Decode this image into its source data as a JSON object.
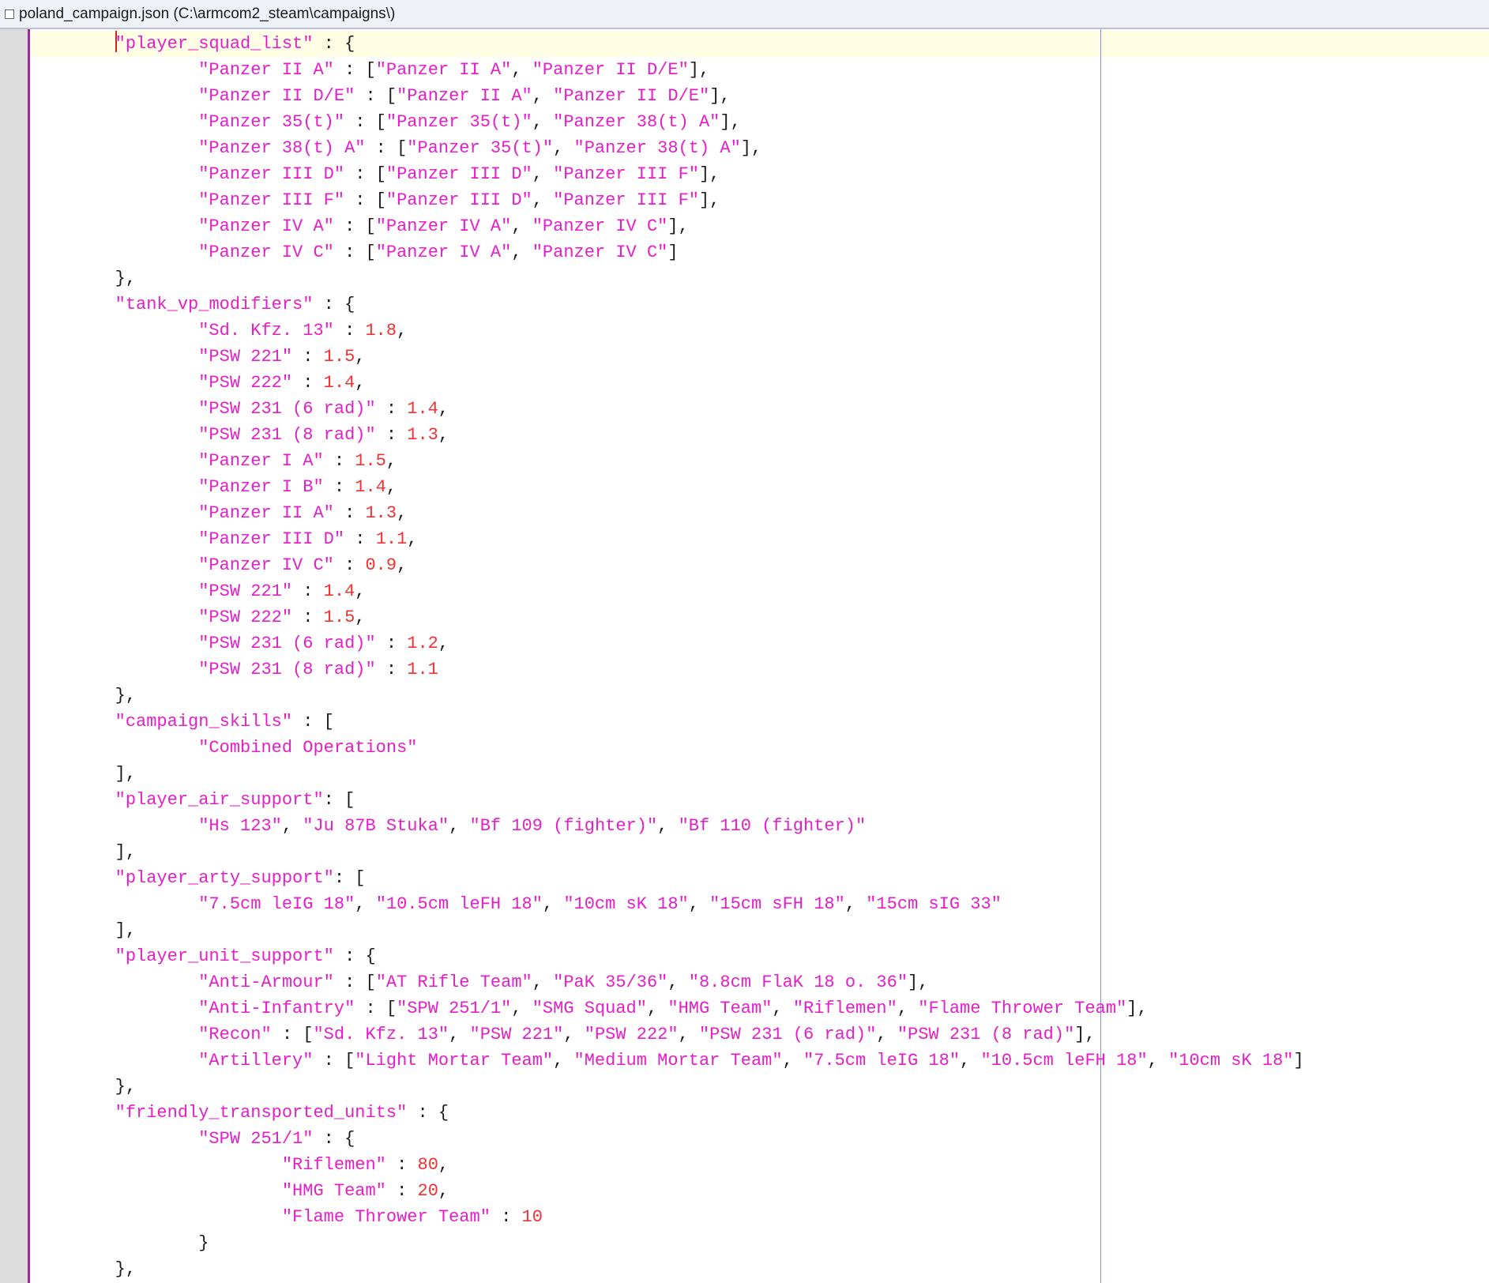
{
  "window": {
    "title": "poland_campaign.json (C:\\armcom2_steam\\campaigns\\)"
  },
  "colors": {
    "string": "#e61ec8",
    "number": "#f03232",
    "punctuation": "#1b1b1b",
    "current_line": "#fffde3",
    "gutter_border": "#9b2a9b",
    "wrap_guide": "#8c8cff"
  },
  "editor": {
    "caret_line": 0,
    "lines": [
      [
        {
          "t": "p",
          "v": "        "
        },
        {
          "t": "s",
          "v": "\"player_squad_list\""
        },
        {
          "t": "p",
          "v": " : {"
        }
      ],
      [
        {
          "t": "p",
          "v": "                "
        },
        {
          "t": "s",
          "v": "\"Panzer II A\""
        },
        {
          "t": "p",
          "v": " : ["
        },
        {
          "t": "s",
          "v": "\"Panzer II A\""
        },
        {
          "t": "p",
          "v": ", "
        },
        {
          "t": "s",
          "v": "\"Panzer II D/E\""
        },
        {
          "t": "p",
          "v": "],"
        }
      ],
      [
        {
          "t": "p",
          "v": "                "
        },
        {
          "t": "s",
          "v": "\"Panzer II D/E\""
        },
        {
          "t": "p",
          "v": " : ["
        },
        {
          "t": "s",
          "v": "\"Panzer II A\""
        },
        {
          "t": "p",
          "v": ", "
        },
        {
          "t": "s",
          "v": "\"Panzer II D/E\""
        },
        {
          "t": "p",
          "v": "],"
        }
      ],
      [
        {
          "t": "p",
          "v": "                "
        },
        {
          "t": "s",
          "v": "\"Panzer 35(t)\""
        },
        {
          "t": "p",
          "v": " : ["
        },
        {
          "t": "s",
          "v": "\"Panzer 35(t)\""
        },
        {
          "t": "p",
          "v": ", "
        },
        {
          "t": "s",
          "v": "\"Panzer 38(t) A\""
        },
        {
          "t": "p",
          "v": "],"
        }
      ],
      [
        {
          "t": "p",
          "v": "                "
        },
        {
          "t": "s",
          "v": "\"Panzer 38(t) A\""
        },
        {
          "t": "p",
          "v": " : ["
        },
        {
          "t": "s",
          "v": "\"Panzer 35(t)\""
        },
        {
          "t": "p",
          "v": ", "
        },
        {
          "t": "s",
          "v": "\"Panzer 38(t) A\""
        },
        {
          "t": "p",
          "v": "],"
        }
      ],
      [
        {
          "t": "p",
          "v": "                "
        },
        {
          "t": "s",
          "v": "\"Panzer III D\""
        },
        {
          "t": "p",
          "v": " : ["
        },
        {
          "t": "s",
          "v": "\"Panzer III D\""
        },
        {
          "t": "p",
          "v": ", "
        },
        {
          "t": "s",
          "v": "\"Panzer III F\""
        },
        {
          "t": "p",
          "v": "],"
        }
      ],
      [
        {
          "t": "p",
          "v": "                "
        },
        {
          "t": "s",
          "v": "\"Panzer III F\""
        },
        {
          "t": "p",
          "v": " : ["
        },
        {
          "t": "s",
          "v": "\"Panzer III D\""
        },
        {
          "t": "p",
          "v": ", "
        },
        {
          "t": "s",
          "v": "\"Panzer III F\""
        },
        {
          "t": "p",
          "v": "],"
        }
      ],
      [
        {
          "t": "p",
          "v": "                "
        },
        {
          "t": "s",
          "v": "\"Panzer IV A\""
        },
        {
          "t": "p",
          "v": " : ["
        },
        {
          "t": "s",
          "v": "\"Panzer IV A\""
        },
        {
          "t": "p",
          "v": ", "
        },
        {
          "t": "s",
          "v": "\"Panzer IV C\""
        },
        {
          "t": "p",
          "v": "],"
        }
      ],
      [
        {
          "t": "p",
          "v": "                "
        },
        {
          "t": "s",
          "v": "\"Panzer IV C\""
        },
        {
          "t": "p",
          "v": " : ["
        },
        {
          "t": "s",
          "v": "\"Panzer IV A\""
        },
        {
          "t": "p",
          "v": ", "
        },
        {
          "t": "s",
          "v": "\"Panzer IV C\""
        },
        {
          "t": "p",
          "v": "]"
        }
      ],
      [
        {
          "t": "p",
          "v": "        },"
        }
      ],
      [
        {
          "t": "p",
          "v": "        "
        },
        {
          "t": "s",
          "v": "\"tank_vp_modifiers\""
        },
        {
          "t": "p",
          "v": " : {"
        }
      ],
      [
        {
          "t": "p",
          "v": "                "
        },
        {
          "t": "s",
          "v": "\"Sd. Kfz. 13\""
        },
        {
          "t": "p",
          "v": " : "
        },
        {
          "t": "n",
          "v": "1.8"
        },
        {
          "t": "p",
          "v": ","
        }
      ],
      [
        {
          "t": "p",
          "v": "                "
        },
        {
          "t": "s",
          "v": "\"PSW 221\""
        },
        {
          "t": "p",
          "v": " : "
        },
        {
          "t": "n",
          "v": "1.5"
        },
        {
          "t": "p",
          "v": ","
        }
      ],
      [
        {
          "t": "p",
          "v": "                "
        },
        {
          "t": "s",
          "v": "\"PSW 222\""
        },
        {
          "t": "p",
          "v": " : "
        },
        {
          "t": "n",
          "v": "1.4"
        },
        {
          "t": "p",
          "v": ","
        }
      ],
      [
        {
          "t": "p",
          "v": "                "
        },
        {
          "t": "s",
          "v": "\"PSW 231 (6 rad)\""
        },
        {
          "t": "p",
          "v": " : "
        },
        {
          "t": "n",
          "v": "1.4"
        },
        {
          "t": "p",
          "v": ","
        }
      ],
      [
        {
          "t": "p",
          "v": "                "
        },
        {
          "t": "s",
          "v": "\"PSW 231 (8 rad)\""
        },
        {
          "t": "p",
          "v": " : "
        },
        {
          "t": "n",
          "v": "1.3"
        },
        {
          "t": "p",
          "v": ","
        }
      ],
      [
        {
          "t": "p",
          "v": "                "
        },
        {
          "t": "s",
          "v": "\"Panzer I A\""
        },
        {
          "t": "p",
          "v": " : "
        },
        {
          "t": "n",
          "v": "1.5"
        },
        {
          "t": "p",
          "v": ","
        }
      ],
      [
        {
          "t": "p",
          "v": "                "
        },
        {
          "t": "s",
          "v": "\"Panzer I B\""
        },
        {
          "t": "p",
          "v": " : "
        },
        {
          "t": "n",
          "v": "1.4"
        },
        {
          "t": "p",
          "v": ","
        }
      ],
      [
        {
          "t": "p",
          "v": "                "
        },
        {
          "t": "s",
          "v": "\"Panzer II A\""
        },
        {
          "t": "p",
          "v": " : "
        },
        {
          "t": "n",
          "v": "1.3"
        },
        {
          "t": "p",
          "v": ","
        }
      ],
      [
        {
          "t": "p",
          "v": "                "
        },
        {
          "t": "s",
          "v": "\"Panzer III D\""
        },
        {
          "t": "p",
          "v": " : "
        },
        {
          "t": "n",
          "v": "1.1"
        },
        {
          "t": "p",
          "v": ","
        }
      ],
      [
        {
          "t": "p",
          "v": "                "
        },
        {
          "t": "s",
          "v": "\"Panzer IV C\""
        },
        {
          "t": "p",
          "v": " : "
        },
        {
          "t": "n",
          "v": "0.9"
        },
        {
          "t": "p",
          "v": ","
        }
      ],
      [
        {
          "t": "p",
          "v": "                "
        },
        {
          "t": "s",
          "v": "\"PSW 221\""
        },
        {
          "t": "p",
          "v": " : "
        },
        {
          "t": "n",
          "v": "1.4"
        },
        {
          "t": "p",
          "v": ","
        }
      ],
      [
        {
          "t": "p",
          "v": "                "
        },
        {
          "t": "s",
          "v": "\"PSW 222\""
        },
        {
          "t": "p",
          "v": " : "
        },
        {
          "t": "n",
          "v": "1.5"
        },
        {
          "t": "p",
          "v": ","
        }
      ],
      [
        {
          "t": "p",
          "v": "                "
        },
        {
          "t": "s",
          "v": "\"PSW 231 (6 rad)\""
        },
        {
          "t": "p",
          "v": " : "
        },
        {
          "t": "n",
          "v": "1.2"
        },
        {
          "t": "p",
          "v": ","
        }
      ],
      [
        {
          "t": "p",
          "v": "                "
        },
        {
          "t": "s",
          "v": "\"PSW 231 (8 rad)\""
        },
        {
          "t": "p",
          "v": " : "
        },
        {
          "t": "n",
          "v": "1.1"
        }
      ],
      [
        {
          "t": "p",
          "v": "        },"
        }
      ],
      [
        {
          "t": "p",
          "v": "        "
        },
        {
          "t": "s",
          "v": "\"campaign_skills\""
        },
        {
          "t": "p",
          "v": " : ["
        }
      ],
      [
        {
          "t": "p",
          "v": "                "
        },
        {
          "t": "s",
          "v": "\"Combined Operations\""
        }
      ],
      [
        {
          "t": "p",
          "v": "        ],"
        }
      ],
      [
        {
          "t": "p",
          "v": "        "
        },
        {
          "t": "s",
          "v": "\"player_air_support\""
        },
        {
          "t": "p",
          "v": ": ["
        }
      ],
      [
        {
          "t": "p",
          "v": "                "
        },
        {
          "t": "s",
          "v": "\"Hs 123\""
        },
        {
          "t": "p",
          "v": ", "
        },
        {
          "t": "s",
          "v": "\"Ju 87B Stuka\""
        },
        {
          "t": "p",
          "v": ", "
        },
        {
          "t": "s",
          "v": "\"Bf 109 (fighter)\""
        },
        {
          "t": "p",
          "v": ", "
        },
        {
          "t": "s",
          "v": "\"Bf 110 (fighter)\""
        }
      ],
      [
        {
          "t": "p",
          "v": "        ],"
        }
      ],
      [
        {
          "t": "p",
          "v": "        "
        },
        {
          "t": "s",
          "v": "\"player_arty_support\""
        },
        {
          "t": "p",
          "v": ": ["
        }
      ],
      [
        {
          "t": "p",
          "v": "                "
        },
        {
          "t": "s",
          "v": "\"7.5cm leIG 18\""
        },
        {
          "t": "p",
          "v": ", "
        },
        {
          "t": "s",
          "v": "\"10.5cm leFH 18\""
        },
        {
          "t": "p",
          "v": ", "
        },
        {
          "t": "s",
          "v": "\"10cm sK 18\""
        },
        {
          "t": "p",
          "v": ", "
        },
        {
          "t": "s",
          "v": "\"15cm sFH 18\""
        },
        {
          "t": "p",
          "v": ", "
        },
        {
          "t": "s",
          "v": "\"15cm sIG 33\""
        }
      ],
      [
        {
          "t": "p",
          "v": "        ],"
        }
      ],
      [
        {
          "t": "p",
          "v": "        "
        },
        {
          "t": "s",
          "v": "\"player_unit_support\""
        },
        {
          "t": "p",
          "v": " : {"
        }
      ],
      [
        {
          "t": "p",
          "v": "                "
        },
        {
          "t": "s",
          "v": "\"Anti-Armour\""
        },
        {
          "t": "p",
          "v": " : ["
        },
        {
          "t": "s",
          "v": "\"AT Rifle Team\""
        },
        {
          "t": "p",
          "v": ", "
        },
        {
          "t": "s",
          "v": "\"PaK 35/36\""
        },
        {
          "t": "p",
          "v": ", "
        },
        {
          "t": "s",
          "v": "\"8.8cm FlaK 18 o. 36\""
        },
        {
          "t": "p",
          "v": "],"
        }
      ],
      [
        {
          "t": "p",
          "v": "                "
        },
        {
          "t": "s",
          "v": "\"Anti-Infantry\""
        },
        {
          "t": "p",
          "v": " : ["
        },
        {
          "t": "s",
          "v": "\"SPW 251/1\""
        },
        {
          "t": "p",
          "v": ", "
        },
        {
          "t": "s",
          "v": "\"SMG Squad\""
        },
        {
          "t": "p",
          "v": ", "
        },
        {
          "t": "s",
          "v": "\"HMG Team\""
        },
        {
          "t": "p",
          "v": ", "
        },
        {
          "t": "s",
          "v": "\"Riflemen\""
        },
        {
          "t": "p",
          "v": ", "
        },
        {
          "t": "s",
          "v": "\"Flame Thrower Team\""
        },
        {
          "t": "p",
          "v": "],"
        }
      ],
      [
        {
          "t": "p",
          "v": "                "
        },
        {
          "t": "s",
          "v": "\"Recon\""
        },
        {
          "t": "p",
          "v": " : ["
        },
        {
          "t": "s",
          "v": "\"Sd. Kfz. 13\""
        },
        {
          "t": "p",
          "v": ", "
        },
        {
          "t": "s",
          "v": "\"PSW 221\""
        },
        {
          "t": "p",
          "v": ", "
        },
        {
          "t": "s",
          "v": "\"PSW 222\""
        },
        {
          "t": "p",
          "v": ", "
        },
        {
          "t": "s",
          "v": "\"PSW 231 (6 rad)\""
        },
        {
          "t": "p",
          "v": ", "
        },
        {
          "t": "s",
          "v": "\"PSW 231 (8 rad)\""
        },
        {
          "t": "p",
          "v": "],"
        }
      ],
      [
        {
          "t": "p",
          "v": "                "
        },
        {
          "t": "s",
          "v": "\"Artillery\""
        },
        {
          "t": "p",
          "v": " : ["
        },
        {
          "t": "s",
          "v": "\"Light Mortar Team\""
        },
        {
          "t": "p",
          "v": ", "
        },
        {
          "t": "s",
          "v": "\"Medium Mortar Team\""
        },
        {
          "t": "p",
          "v": ", "
        },
        {
          "t": "s",
          "v": "\"7.5cm leIG 18\""
        },
        {
          "t": "p",
          "v": ", "
        },
        {
          "t": "s",
          "v": "\"10.5cm leFH 18\""
        },
        {
          "t": "p",
          "v": ", "
        },
        {
          "t": "s",
          "v": "\"10cm sK 18\""
        },
        {
          "t": "p",
          "v": "]"
        }
      ],
      [
        {
          "t": "p",
          "v": "        },"
        }
      ],
      [
        {
          "t": "p",
          "v": "        "
        },
        {
          "t": "s",
          "v": "\"friendly_transported_units\""
        },
        {
          "t": "p",
          "v": " : {"
        }
      ],
      [
        {
          "t": "p",
          "v": "                "
        },
        {
          "t": "s",
          "v": "\"SPW 251/1\""
        },
        {
          "t": "p",
          "v": " : {"
        }
      ],
      [
        {
          "t": "p",
          "v": "                        "
        },
        {
          "t": "s",
          "v": "\"Riflemen\""
        },
        {
          "t": "p",
          "v": " : "
        },
        {
          "t": "n",
          "v": "80"
        },
        {
          "t": "p",
          "v": ","
        }
      ],
      [
        {
          "t": "p",
          "v": "                        "
        },
        {
          "t": "s",
          "v": "\"HMG Team\""
        },
        {
          "t": "p",
          "v": " : "
        },
        {
          "t": "n",
          "v": "20"
        },
        {
          "t": "p",
          "v": ","
        }
      ],
      [
        {
          "t": "p",
          "v": "                        "
        },
        {
          "t": "s",
          "v": "\"Flame Thrower Team\""
        },
        {
          "t": "p",
          "v": " : "
        },
        {
          "t": "n",
          "v": "10"
        }
      ],
      [
        {
          "t": "p",
          "v": "                }"
        }
      ],
      [
        {
          "t": "p",
          "v": "        },"
        }
      ]
    ]
  }
}
